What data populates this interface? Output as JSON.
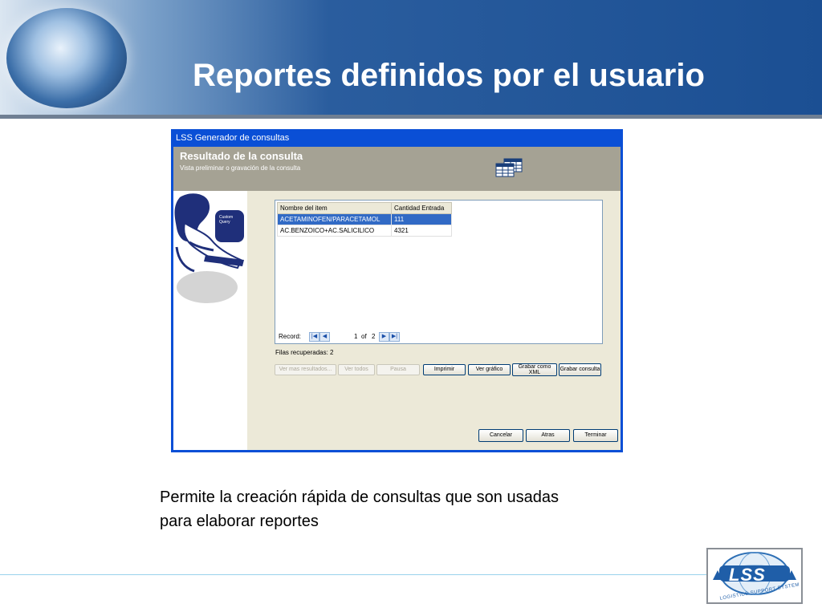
{
  "slide": {
    "title": "Reportes definidos por el usuario",
    "caption_line1": "Permite la creación rápida de consultas que son usadas",
    "caption_line2": "para elaborar reportes"
  },
  "window": {
    "title": "LSS Generador de consultas",
    "header_title": "Resultado de la consulta",
    "header_subtitle": "Vista preliminar o gravación de la consulta",
    "illustration_text": "Custom Query"
  },
  "grid": {
    "columns": [
      "Nombre del item",
      "Cantidad Entrada"
    ],
    "rows": [
      [
        "ACETAMINOFEN/PARACETAMOL",
        "111"
      ],
      [
        "AC.BENZOICO+AC.SALICILICO",
        "4321"
      ]
    ],
    "selected_row": 0
  },
  "navigator": {
    "label": "Record:",
    "current": "1",
    "of_label": "of",
    "total": "2"
  },
  "rows_fetched": "Filas recuperadas: 2",
  "buttons": {
    "more_results": "Ver mas resultados...",
    "view_all": "Ver todos",
    "pause": "Pausa",
    "print": "Imprimir",
    "chart": "Ver gráfico",
    "save_xml": "Grabar como XML",
    "save_query": "Grabar consulta",
    "cancel": "Cancelar",
    "back": "Atras",
    "finish": "Terminar"
  },
  "logo": {
    "text": "LSS",
    "subtitle": "LOGISTICS SUPPORT SYSTEM"
  },
  "colors": {
    "banner_dark": "#1b4f93",
    "window_frame": "#0a4fd6",
    "selection": "#316ac5",
    "dialog_bg": "#ece9d8"
  }
}
